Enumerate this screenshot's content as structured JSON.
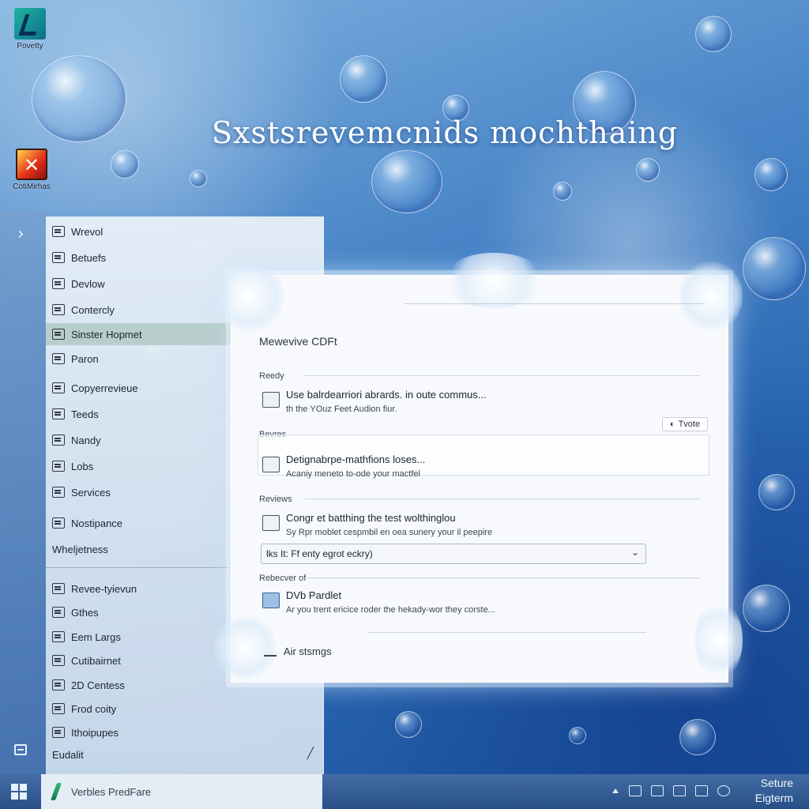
{
  "desktop": {
    "icons": [
      {
        "label": "Povetty",
        "icon": "app-shortcut-icon"
      },
      {
        "label": "CotiMirhas",
        "icon": "red-x-app-icon"
      }
    ],
    "hero_title": "Sxstsrevemcnids mochthaing"
  },
  "nav_rail": {
    "expand_icon": "chevron-right-icon",
    "bottom_icon": "window-icon"
  },
  "menu": {
    "items": [
      {
        "label": "Wrevol"
      },
      {
        "label": "Betuefs"
      },
      {
        "label": "Devlow"
      },
      {
        "label": "Contercly"
      },
      {
        "label": "Sinster Hopmet"
      },
      {
        "label": "Paron"
      },
      {
        "label": "Copyerrevieue"
      },
      {
        "label": "Teeds"
      },
      {
        "label": "Nandy"
      },
      {
        "label": "Lobs"
      },
      {
        "label": "Services"
      },
      {
        "label": "Nostipance"
      }
    ],
    "group_heading": "Wheljetness",
    "items2": [
      {
        "label": "Revee-tyievun"
      },
      {
        "label": "Gthes"
      },
      {
        "label": "Eem Largs"
      },
      {
        "label": "Cutibairnet"
      },
      {
        "label": "2D Centess"
      },
      {
        "label": "Frod coity"
      },
      {
        "label": "Ithoipupes"
      }
    ],
    "footer_label": "Eudalit",
    "active_index": 4
  },
  "dialog": {
    "title": "Mewevive CDFt",
    "sections": [
      {
        "label": "Reedy",
        "title": "Use balrdearriori abrards. in oute commus...",
        "desc": "th the YOuz Feet Audion fiur."
      },
      {
        "label": "Bevres",
        "title": "Detignabrpe-mathfions loses...",
        "desc": "Acaniy meneto to-ode your mactfel"
      },
      {
        "label": "Reviews",
        "title": "Congr et batthing the test wolthinglou",
        "desc": "Sy Rpr moblet cespmbil en oea sunery your il peepire"
      },
      {
        "label": "Rebecver of",
        "title": "DVb Pardlet",
        "desc": "Ar you trent ericice roder the hekady-wor they corste..."
      }
    ],
    "toggle_label": "Tvote",
    "select_value": "lks It: Ff enty egrot eckry)",
    "footer_item": "Air stsmgs"
  },
  "taskbar": {
    "start_icon": "windows-start-icon",
    "app_label": "Verbles PredFare",
    "tray_icons": [
      "arrow-up-icon",
      "network-icon",
      "message-icon",
      "display-icon",
      "battery-icon",
      "settings-icon"
    ],
    "clock_line1": "Seture",
    "clock_line2": "Eigterm"
  }
}
